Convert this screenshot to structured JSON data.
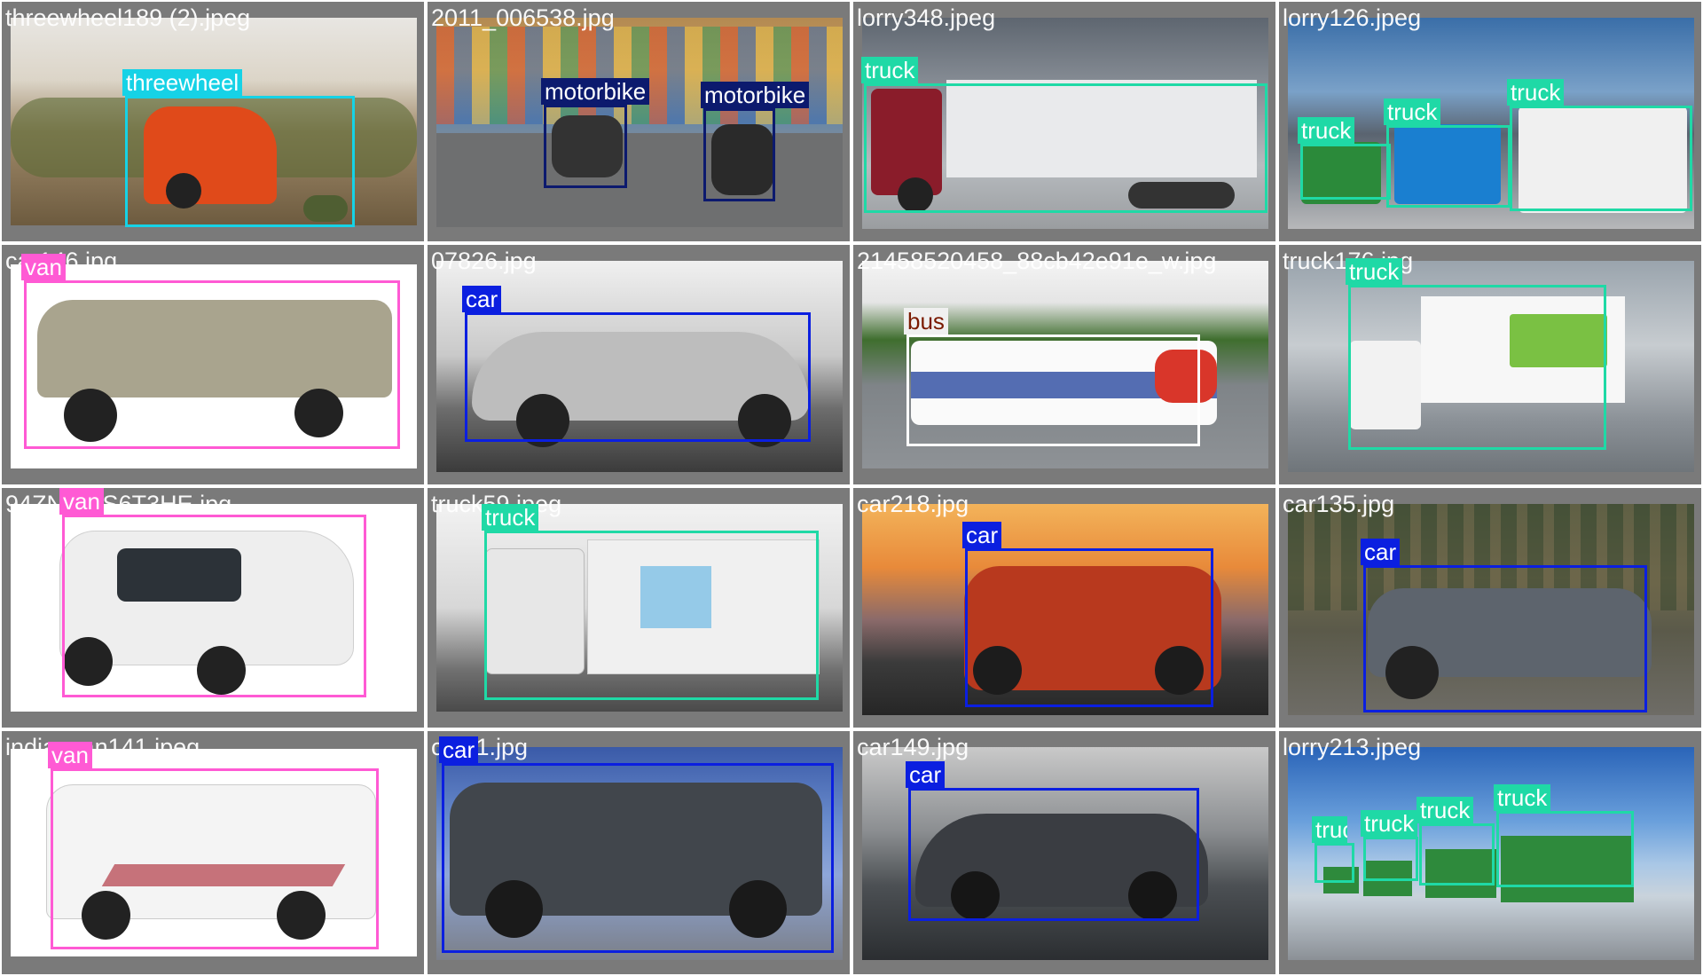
{
  "colors": {
    "truck": "#1fd9a6",
    "car": "#0b1fe0",
    "van": "#ff5ad4",
    "motorbike": "#0c1a6e",
    "threewheel": "#16d2e6",
    "bus": "#ffffff",
    "bus_label_bg": "#f0f0f0",
    "bus_label_text": "#7a1a00",
    "tile_bg": "#7a7a7a"
  },
  "tiles": [
    {
      "filename": "threewheel189 (2).jpeg",
      "labels": [
        "threewheel"
      ]
    },
    {
      "filename": "2011_006538.jpg",
      "labels": [
        "motorbike",
        "motorbike"
      ]
    },
    {
      "filename": "lorry348.jpeg",
      "labels": [
        "truck"
      ]
    },
    {
      "filename": "lorry126.jpeg",
      "labels": [
        "truck",
        "truck",
        "truck"
      ]
    },
    {
      "filename": "car146.jpg",
      "labels": [
        "van"
      ]
    },
    {
      "filename": "07826.jpg",
      "labels": [
        "car"
      ]
    },
    {
      "filename": "21458520458_88cb42e91e_w.jpg",
      "labels": [
        "bus"
      ]
    },
    {
      "filename": "truck176.jpg",
      "labels": [
        "truck"
      ]
    },
    {
      "filename": "94ZNvanS6T3HE.jpg",
      "labels": [
        "van"
      ]
    },
    {
      "filename": "truck59.jpeg",
      "labels": [
        "truck"
      ]
    },
    {
      "filename": "car218.jpg",
      "labels": [
        "car"
      ]
    },
    {
      "filename": "car135.jpg",
      "labels": [
        "car"
      ]
    },
    {
      "filename": "indianvan141.jpeg",
      "labels": [
        "van"
      ]
    },
    {
      "filename": "car11.jpg",
      "labels": [
        "car"
      ]
    },
    {
      "filename": "car149.jpg",
      "labels": [
        "car"
      ]
    },
    {
      "filename": "lorry213.jpeg",
      "labels": [
        "truck",
        "truck",
        "truck",
        "truck"
      ]
    }
  ]
}
